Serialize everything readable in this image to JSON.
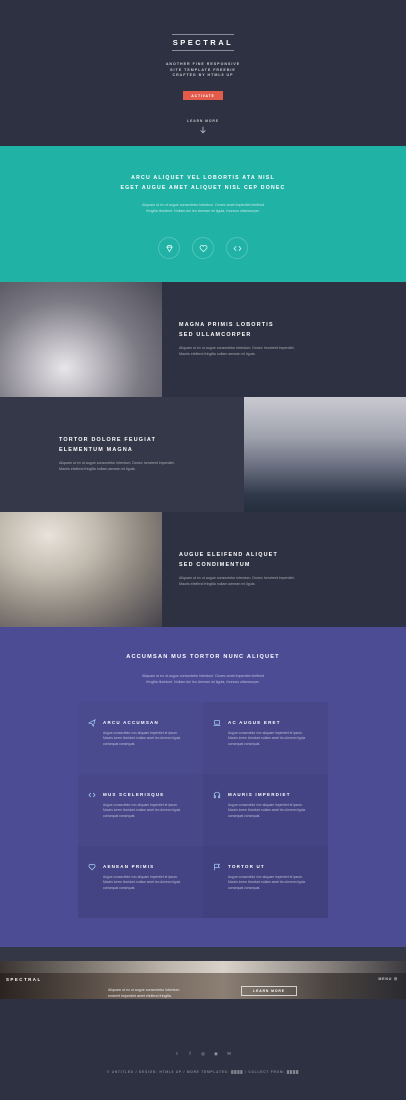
{
  "hero": {
    "brand": "SPECTRAL",
    "tagline_1": "ANOTHER FINE RESPONSIVE",
    "tagline_2": "SITE TEMPLATE FREEBIE",
    "tagline_3": "CRAFTED BY HTML5 UP",
    "activate_label": "ACTIVATE",
    "learn_more": "LEARN MORE",
    "arrow_icon": "arrow-down-icon",
    "accent_color": "#e35b4a"
  },
  "banner": {
    "title_1": "ARCU ALIQUET VEL LOBORTIS ATA NISL",
    "title_2": "EGET AUGUE AMET ALIQUET NISL CEP DONEC",
    "text_1": "Aliquam ut ex ut augue consectetur interdum. Donec amet imperdiet eleifend",
    "text_2": "fringilla tincidunt. Nullam dui leo Aenean mi ligula, rhoncus ullamcorper.",
    "icons": [
      "diamond-icon",
      "heart-icon",
      "code-icon"
    ],
    "color": "#21b2a6"
  },
  "spotlights": [
    {
      "title_1": "MAGNA PRIMIS LOBORTIS",
      "title_2": "SED ULLAMCORPER",
      "text_1": "Aliquam ut ex ut augue consectetur interdum. Donec hendrerit imperdiet.",
      "text_2": "Mauris eleifend fringilla nullam aenean mi ligula."
    },
    {
      "title_1": "TORTOR DOLORE FEUGIAT",
      "title_2": "ELEMENTUM MAGNA",
      "text_1": "Aliquam ut ex ut augue consectetur interdum. Donec hendrerit imperdiet.",
      "text_2": "Mauris eleifend fringilla nullam aenean mi ligula."
    },
    {
      "title_1": "AUGUE ELEIFEND ALIQUET",
      "title_2": "SED CONDIMENTUM",
      "text_1": "Aliquam ut ex ut augue consectetur interdum. Donec hendrerit imperdiet.",
      "text_2": "Mauris eleifend fringilla nullam aenean mi ligula."
    }
  ],
  "features": {
    "title": "ACCUMSAN MUS TORTOR NUNC ALIQUET",
    "text_1": "Aliquam ut ex ut augue consectetur interdum. Donec amet imperdiet eleifend",
    "text_2": "fringilla tincidunt. Nullam dui leo Aenean mi ligula, rhoncus ullamcorper.",
    "color": "#4c4c95",
    "items": [
      {
        "icon": "paper-plane-icon",
        "title": "ARCU ACCUMSAN",
        "text": "Augue consectetur nec aliquam imperdiet et ipsum. Mauris lorem tincidunt nullam amet leo Aenean ligula consequat consequat."
      },
      {
        "icon": "laptop-icon",
        "title": "AC AUGUE ERET",
        "text": "Augue consectetur nec aliquam imperdiet et ipsum. Mauris lorem tincidunt nullam amet leo Aenean ligula consequat consequat."
      },
      {
        "icon": "code-icon",
        "title": "MUS SCELERISQUE",
        "text": "Augue consectetur nec aliquam imperdiet et ipsum. Mauris lorem tincidunt nullam amet leo Aenean ligula consequat consequat."
      },
      {
        "icon": "headphones-icon",
        "title": "MAURIS IMPERDIET",
        "text": "Augue consectetur nec aliquam imperdiet et ipsum. Mauris lorem tincidunt nullam amet leo Aenean ligula consequat consequat."
      },
      {
        "icon": "heart-icon",
        "title": "AENEAN PRIMIS",
        "text": "Augue consectetur nec aliquam imperdiet et ipsum. Mauris lorem tincidunt nullam amet leo Aenean ligula consequat consequat."
      },
      {
        "icon": "flag-icon",
        "title": "TORTOR UT",
        "text": "Augue consectetur nec aliquam imperdiet et ipsum. Mauris lorem tincidunt nullam amet leo Aenean ligula consequat consequat."
      }
    ]
  },
  "navbar": {
    "brand": "SPECTRAL",
    "menu": "MENU ☰",
    "text_1": "Aliquam ut ex ut augue consectetur interdum",
    "text_2": "endrerit imperdiet amet eleifend fringilla.",
    "button_label": "LEARN MORE"
  },
  "footer": {
    "social_icons": [
      "twitter-icon",
      "facebook-icon",
      "instagram-icon",
      "dribbble-icon",
      "mail-icon"
    ],
    "social_glyphs": [
      "t",
      "f",
      "◎",
      "◉",
      "✉"
    ],
    "copyright": "© UNTITLED  /  DESIGN: HTML5 UP  /  MORE TEMPLATES: ████  /  COLLECT FROM: ████"
  }
}
